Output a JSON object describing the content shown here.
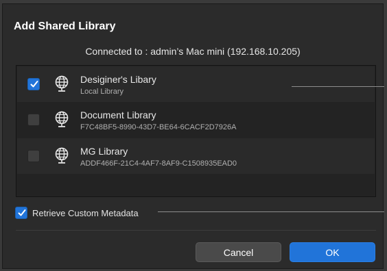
{
  "dialog": {
    "title": "Add Shared Library",
    "connected": "Connected to : admin’s Mac mini (192.168.10.205)"
  },
  "libraries": [
    {
      "name": "Desiginer's Libary",
      "sub": "Local Library",
      "checked": true,
      "icon": "globe-icon"
    },
    {
      "name": "Document Library",
      "sub": "F7C48BF5-8990-43D7-BE64-6CACF2D7926A",
      "checked": false,
      "icon": "globe-icon"
    },
    {
      "name": "MG Library",
      "sub": "ADDF466F-21C4-4AF7-8AF9-C1508935EAD0",
      "checked": false,
      "icon": "globe-icon"
    }
  ],
  "metadata": {
    "label": "Retrieve Custom Metadata",
    "checked": true
  },
  "buttons": {
    "cancel": "Cancel",
    "ok": "OK"
  },
  "colors": {
    "accent": "#2174d9",
    "background": "#2b2b2b"
  }
}
